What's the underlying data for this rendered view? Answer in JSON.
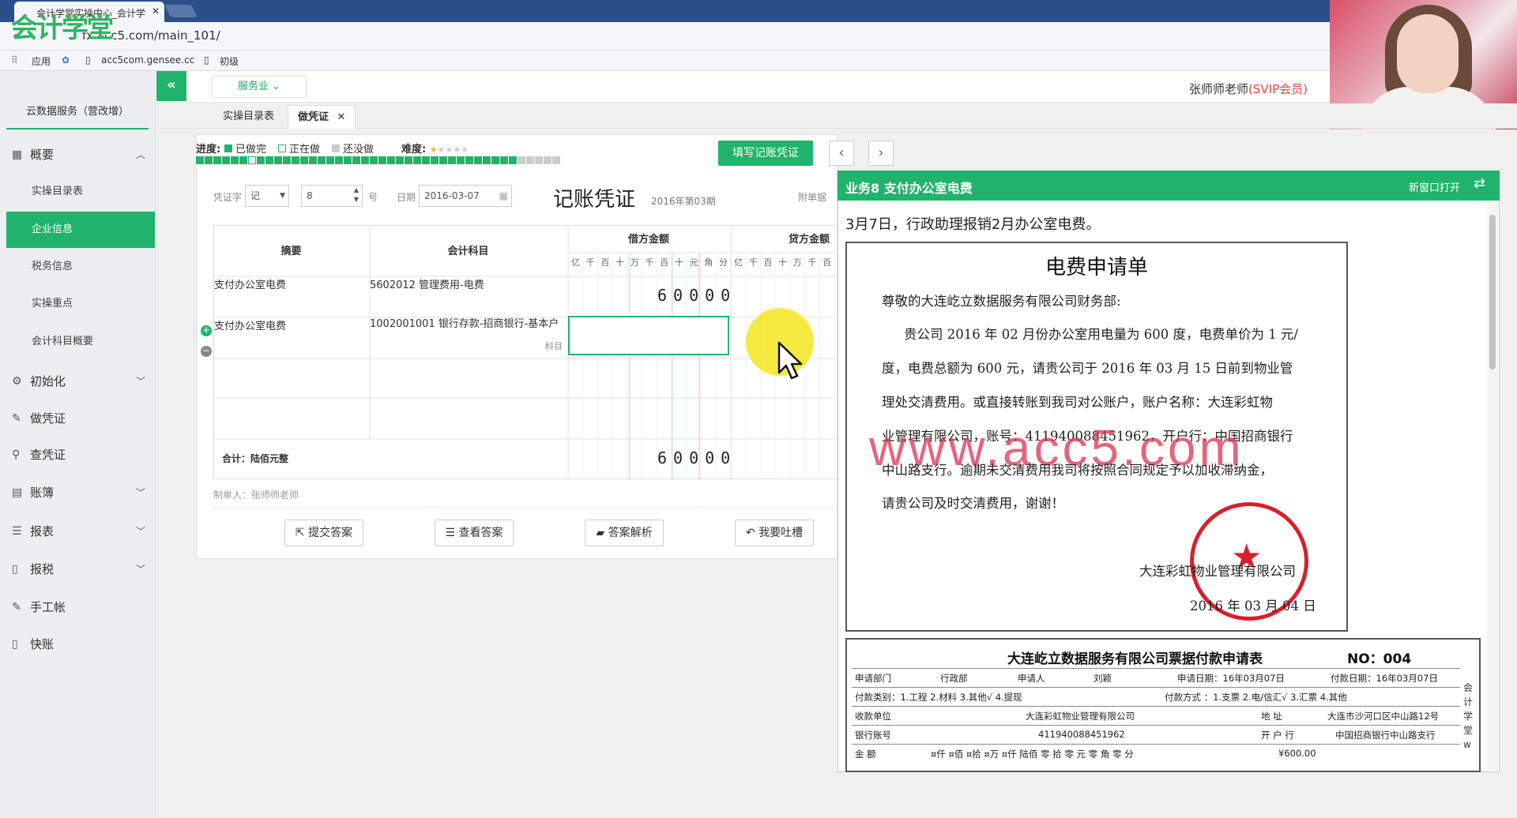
{
  "browser": {
    "tab_title": "会计学堂实操中心_会计学",
    "url": "fx.acc5.com/main_101/",
    "logo_text": "会计学堂",
    "bookmarks": [
      "应用",
      "acc5com.gensee.cc",
      "初级"
    ]
  },
  "header": {
    "industry_select": "服务业",
    "user": "张师师老师",
    "vip": "(SVIP会员)"
  },
  "sidebar": {
    "title": "云数据服务（营改增）",
    "items": [
      {
        "label": "概要",
        "icon": "grid-icon"
      },
      {
        "label": "初始化",
        "icon": "gear-icon"
      },
      {
        "label": "做凭证",
        "icon": "pen-icon"
      },
      {
        "label": "查凭证",
        "icon": "search-icon"
      },
      {
        "label": "账簿",
        "icon": "book-icon"
      },
      {
        "label": "报表",
        "icon": "list-icon"
      },
      {
        "label": "报税",
        "icon": "file-icon"
      },
      {
        "label": "手工帐",
        "icon": "pen-icon"
      },
      {
        "label": "快账",
        "icon": "file-icon"
      }
    ],
    "sub_items": [
      "实操目录表",
      "企业信息",
      "税务信息",
      "实操重点",
      "会计科目概要"
    ]
  },
  "tabs": [
    "实操目录表",
    "做凭证"
  ],
  "progress": {
    "label": "进度:",
    "done": "已做完",
    "doing": "正在做",
    "todo": "还没做",
    "difficulty": "难度:",
    "colors": {
      "done": "#21b36b",
      "doing": "#ffffff",
      "todo": "#cccccc"
    }
  },
  "fill_button": "填写记账凭证",
  "voucher": {
    "word_label": "凭证字",
    "word_value": "记",
    "number": "8",
    "number_suffix": "号",
    "date_label": "日期",
    "date": "2016-03-07",
    "title": "记账凭证",
    "period": "2016年第03期",
    "attach_label": "附单据",
    "headers": {
      "summary": "摘要",
      "account": "会计科目",
      "debit": "借方金额",
      "credit": "贷方金额"
    },
    "digits": [
      "亿",
      "千",
      "百",
      "十",
      "万",
      "千",
      "百",
      "十",
      "元",
      "角",
      "分"
    ],
    "rows": [
      {
        "summary": "支付办公室电费",
        "account": "5602012 管理费用-电费",
        "debit": "60000"
      },
      {
        "summary": "支付办公室电费",
        "account": "1002001001 银行存款-招商银行-基本户",
        "account_hint": "科目",
        "debit": ""
      }
    ],
    "total_label": "合计：陆佰元整",
    "total_debit": "60000",
    "maker": "制单人：张师师老师"
  },
  "buttons": [
    "提交答案",
    "查看答案",
    "答案解析",
    "我要吐槽"
  ],
  "doc_panel": {
    "title": "业务8 支付办公室电费",
    "new_window": "新窗口打开",
    "task": "3月7日，行政助理报销2月办公室电费。",
    "letter": {
      "title": "电费申请单",
      "lines": [
        "尊敬的大连屹立数据服务有限公司财务部:",
        "贵公司 2016 年 02 月份办公室用电量为 600 度，电费单价为 1 元/",
        "度，电费总额为 600 元，请贵公司于 2016 年 03 月 15 日前到物业管",
        "理处交清费用。或直接转账到我司对公账户，账户名称：大连彩虹物",
        "业管理有限公司，账号：411940088451962，开户行：中国招商银行",
        "中山路支行。逾期未交清费用我司将按照合同规定予以加收滞纳金，",
        "请贵公司及时交清费用，谢谢！",
        "大连彩虹物业管理有限公司",
        "2016 年 03 月 04 日"
      ],
      "watermark": "www.acc5.com"
    },
    "form": {
      "title": "大连屹立数据服务有限公司票据付款申请表",
      "no": "NO：004",
      "rows": [
        [
          "申请部门",
          "行政部",
          "申请人",
          "刘颖",
          "申请日期：16年03月07日",
          "付款日期：16年03月07日"
        ],
        [
          "付款类别：1.工程 2.材料 3.其他√ 4.提现",
          "付款方式 ：1.支票 2.电/信汇√ 3.汇票 4.其他"
        ],
        [
          "收款单位",
          "大连彩虹物业管理有限公司",
          "地  址",
          "大连市沙河口区中山路12号"
        ],
        [
          "银行账号",
          "411940088451962",
          "开 户 行",
          "中国招商银行中山路支行"
        ],
        [
          "金    额",
          "¤仟 ¤佰 ¤拾 ¤万 ¤仟 陆佰 零 拾 零 元 零 角 零 分",
          "¥600.00"
        ]
      ],
      "side_text": "会计学堂w"
    }
  }
}
